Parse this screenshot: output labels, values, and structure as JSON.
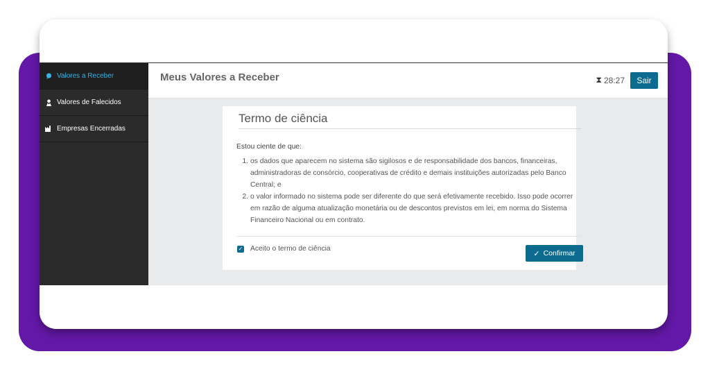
{
  "sidebar": {
    "items": [
      {
        "label": "Valores a Receber",
        "icon": "chat-icon",
        "active": true
      },
      {
        "label": "Valores de Falecidos",
        "icon": "person-icon",
        "active": false
      },
      {
        "label": "Empresas Encerradas",
        "icon": "factory-icon",
        "active": false
      }
    ]
  },
  "header": {
    "title": "Meus Valores a Receber",
    "timer": "28:27",
    "exit_label": "Sair"
  },
  "card": {
    "title": "Termo de ciência",
    "intro": "Estou ciente de que:",
    "items": [
      "os dados que aparecem no sistema são sigilosos e de responsabilidade dos bancos, financeiras, administradoras de consórcio, cooperativas de crédito e demais instituições autorizadas pelo Banco Central; e",
      "o valor informado no sistema pode ser diferente do que será efetivamente recebido. Isso pode ocorrer em razão de alguma atualização monetária ou de descontos previstos em lei, em norma do Sistema Financeiro Nacional ou em contrato."
    ],
    "checkbox_label": "Aceito o termo de ciência",
    "checkbox_checked": true,
    "confirm_label": "Confirmar"
  },
  "colors": {
    "accent": "#0c6b8f",
    "purple": "#6418a8",
    "sidebar_active_text": "#36b3e2",
    "sidebar_bg": "#2b2b2b"
  }
}
